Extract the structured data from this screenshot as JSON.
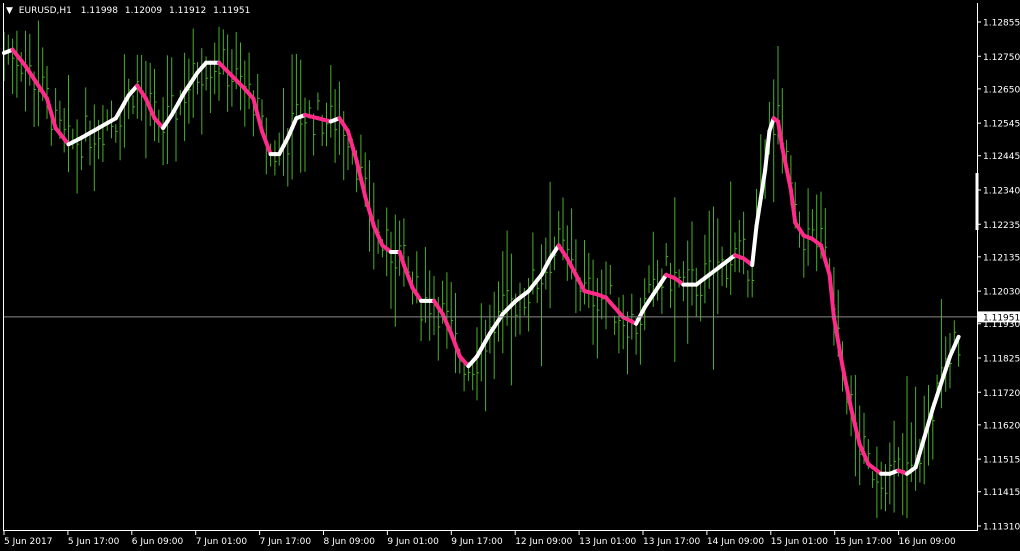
{
  "header": {
    "symbol": "EURUSD,H1",
    "open": "1.11998",
    "high": "1.12009",
    "low": "1.11912",
    "close": "1.11951"
  },
  "colors": {
    "background": "#000000",
    "bars": "#4caf2a",
    "ma_up": "#ffffff",
    "ma_down": "#ff2a8a",
    "axis": "#ffffff",
    "price_line": "#8a8a8a"
  },
  "chart_data": {
    "type": "line",
    "instrument": "EURUSD",
    "timeframe": "H1",
    "ylim": [
      1.1128,
      1.129
    ],
    "y_ticks": [
      "1.12855",
      "1.12750",
      "1.12650",
      "1.12545",
      "1.12445",
      "1.12340",
      "1.12235",
      "1.12135",
      "1.12030",
      "1.11930",
      "1.11825",
      "1.11720",
      "1.11620",
      "1.11515",
      "1.11415",
      "1.11310"
    ],
    "x_ticks": [
      "5 Jun 2017",
      "5 Jun 17:00",
      "6 Jun 09:00",
      "7 Jun 01:00",
      "7 Jun 17:00",
      "8 Jun 09:00",
      "9 Jun 01:00",
      "9 Jun 17:00",
      "12 Jun 09:00",
      "13 Jun 01:00",
      "13 Jun 17:00",
      "14 Jun 09:00",
      "15 Jun 01:00",
      "15 Jun 17:00",
      "16 Jun 09:00"
    ],
    "current_price": "1.11951",
    "ma_series": [
      [
        0,
        1.1276
      ],
      [
        2,
        1.1277
      ],
      [
        5,
        1.1272
      ],
      [
        7,
        1.1268
      ],
      [
        10,
        1.1262
      ],
      [
        12,
        1.1253
      ],
      [
        15,
        1.1248
      ],
      [
        18,
        1.125
      ],
      [
        22,
        1.1253
      ],
      [
        26,
        1.1256
      ],
      [
        29,
        1.1263
      ],
      [
        31,
        1.1266
      ],
      [
        33,
        1.1262
      ],
      [
        35,
        1.1256
      ],
      [
        37,
        1.1253
      ],
      [
        39,
        1.1257
      ],
      [
        42,
        1.1264
      ],
      [
        45,
        1.127
      ],
      [
        47,
        1.1273
      ],
      [
        50,
        1.1273
      ],
      [
        53,
        1.1269
      ],
      [
        56,
        1.1265
      ],
      [
        58,
        1.1262
      ],
      [
        60,
        1.1252
      ],
      [
        62,
        1.1245
      ],
      [
        64,
        1.1245
      ],
      [
        66,
        1.125
      ],
      [
        68,
        1.1256
      ],
      [
        70,
        1.1257
      ],
      [
        73,
        1.1256
      ],
      [
        76,
        1.1255
      ],
      [
        78,
        1.1256
      ],
      [
        80,
        1.1252
      ],
      [
        82,
        1.1243
      ],
      [
        84,
        1.1232
      ],
      [
        86,
        1.1223
      ],
      [
        88,
        1.1217
      ],
      [
        90,
        1.1215
      ],
      [
        92,
        1.1215
      ],
      [
        93,
        1.1211
      ],
      [
        95,
        1.1204
      ],
      [
        97,
        1.12
      ],
      [
        100,
        1.12
      ],
      [
        102,
        1.1196
      ],
      [
        104,
        1.119
      ],
      [
        106,
        1.1183
      ],
      [
        108,
        1.118
      ],
      [
        110,
        1.1183
      ],
      [
        113,
        1.119
      ],
      [
        116,
        1.1196
      ],
      [
        119,
        1.12
      ],
      [
        122,
        1.1203
      ],
      [
        125,
        1.1208
      ],
      [
        127,
        1.1213
      ],
      [
        129,
        1.1217
      ],
      [
        131,
        1.1213
      ],
      [
        133,
        1.1208
      ],
      [
        135,
        1.1203
      ],
      [
        138,
        1.1202
      ],
      [
        140,
        1.1201
      ],
      [
        142,
        1.1198
      ],
      [
        144,
        1.1195
      ],
      [
        147,
        1.1193
      ],
      [
        149,
        1.1198
      ],
      [
        152,
        1.1204
      ],
      [
        154,
        1.1208
      ],
      [
        156,
        1.1207
      ],
      [
        158,
        1.1205
      ],
      [
        161,
        1.1205
      ],
      [
        164,
        1.1208
      ],
      [
        167,
        1.1211
      ],
      [
        170,
        1.1214
      ],
      [
        172,
        1.1213
      ],
      [
        174,
        1.1211
      ],
      [
        175,
        1.1223
      ],
      [
        177,
        1.124
      ],
      [
        178,
        1.1252
      ],
      [
        179,
        1.1256
      ],
      [
        180,
        1.1255
      ],
      [
        181,
        1.1247
      ],
      [
        183,
        1.1234
      ],
      [
        184,
        1.1224
      ],
      [
        186,
        1.122
      ],
      [
        188,
        1.1219
      ],
      [
        190,
        1.1217
      ],
      [
        192,
        1.1208
      ],
      [
        193,
        1.1195
      ],
      [
        195,
        1.118
      ],
      [
        197,
        1.1167
      ],
      [
        199,
        1.1156
      ],
      [
        201,
        1.115
      ],
      [
        204,
        1.1147
      ],
      [
        206,
        1.1147
      ],
      [
        208,
        1.1148
      ],
      [
        210,
        1.1147
      ],
      [
        212,
        1.1149
      ],
      [
        214,
        1.1158
      ],
      [
        216,
        1.1167
      ],
      [
        218,
        1.1175
      ],
      [
        220,
        1.1183
      ],
      [
        222,
        1.1189
      ]
    ],
    "ma_directions": "white when rising, magenta when falling"
  }
}
